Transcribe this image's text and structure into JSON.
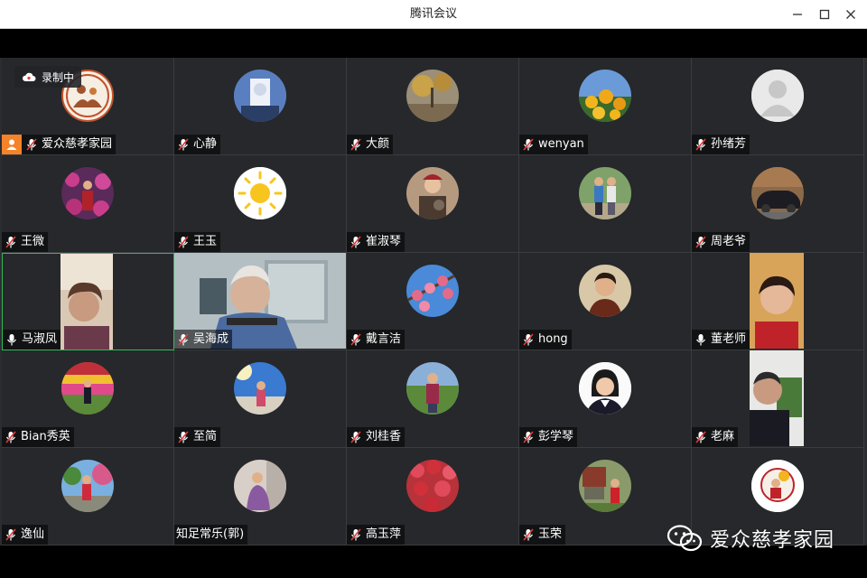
{
  "window": {
    "title": "腾讯会议"
  },
  "recording": {
    "label": "录制中"
  },
  "watermark": {
    "text": "爱众慈孝家园"
  },
  "participants": [
    {
      "name": "爱众慈孝家园",
      "host": true
    },
    {
      "name": "心静"
    },
    {
      "name": "大颜"
    },
    {
      "name": "wenyan"
    },
    {
      "name": "孙绪芳"
    },
    {
      "name": "王微"
    },
    {
      "name": "王玉"
    },
    {
      "name": "崔淑琴"
    },
    {
      "name": ""
    },
    {
      "name": "周老爷"
    },
    {
      "name": "马淑凤",
      "speaking": true
    },
    {
      "name": "吴海成"
    },
    {
      "name": "戴言洁"
    },
    {
      "name": "hong"
    },
    {
      "name": "董老师"
    },
    {
      "name": "Bian秀英"
    },
    {
      "name": "至简"
    },
    {
      "name": "刘桂香"
    },
    {
      "name": "彭学琴"
    },
    {
      "name": "老麻"
    },
    {
      "name": "逸仙"
    },
    {
      "name": "知足常乐(郭)"
    },
    {
      "name": "高玉萍"
    },
    {
      "name": "玉荣"
    },
    {
      "name": ""
    }
  ]
}
